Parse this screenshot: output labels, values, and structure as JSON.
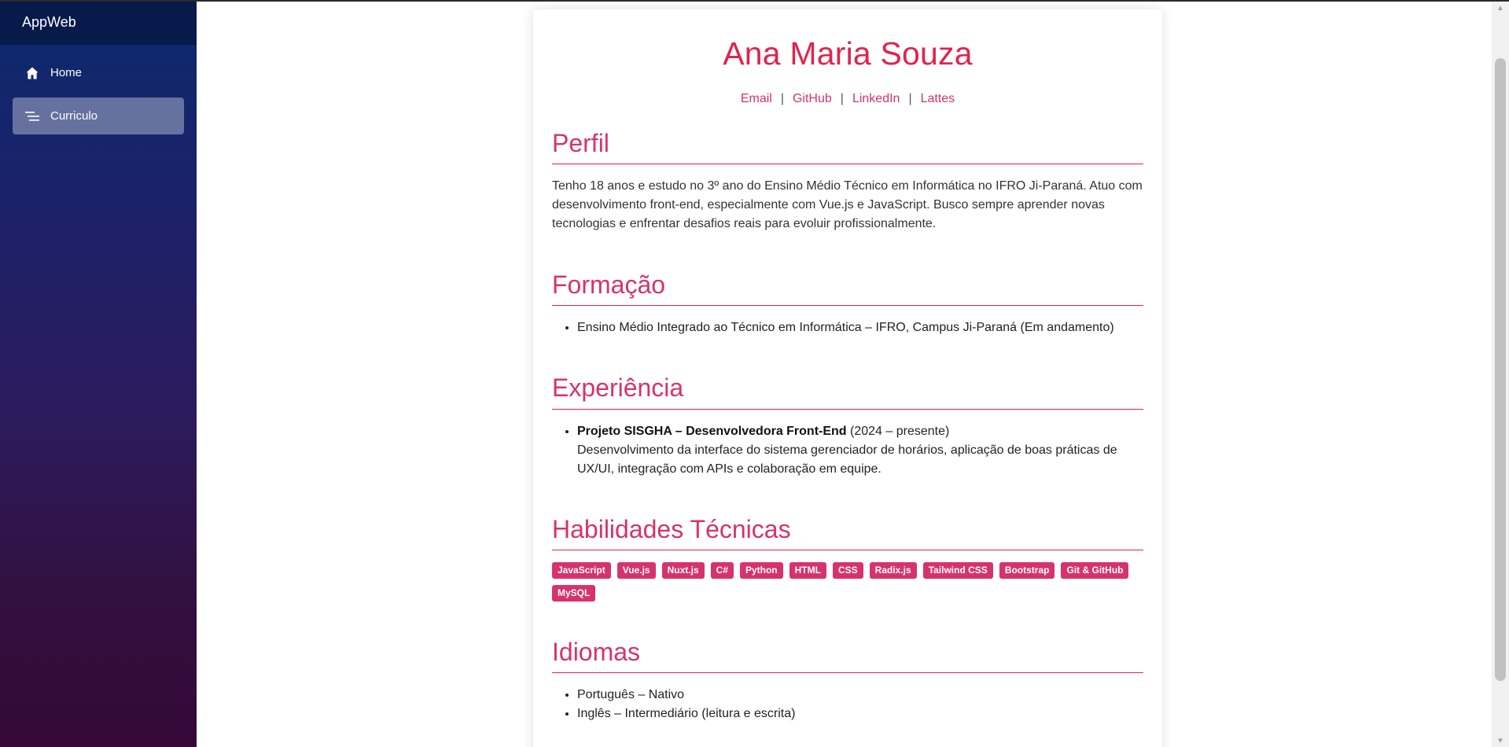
{
  "sidebar": {
    "brand": "AppWeb",
    "items": [
      {
        "label": "Home",
        "icon": "home-icon",
        "active": false
      },
      {
        "label": "Curriculo",
        "icon": "sort-lines-icon",
        "active": true
      }
    ]
  },
  "resume": {
    "name": "Ana Maria Souza",
    "links": [
      "Email",
      "GitHub",
      "LinkedIn",
      "Lattes"
    ],
    "separator": "|",
    "profile": {
      "title": "Perfil",
      "text": "Tenho 18 anos e estudo no 3º ano do Ensino Médio Técnico em Informática no IFRO Ji-Paraná. Atuo com desenvolvimento front-end, especialmente com Vue.js e JavaScript. Busco sempre aprender novas tecnologias e enfrentar desafios reais para evoluir profissionalmente."
    },
    "education": {
      "title": "Formação",
      "items": [
        "Ensino Médio Integrado ao Técnico em Informática – IFRO, Campus Ji-Paraná (Em andamento)"
      ]
    },
    "experience": {
      "title": "Experiência",
      "items": [
        {
          "role": "Projeto SISGHA – Desenvolvedora Front-End",
          "period": " (2024 – presente)",
          "description": "Desenvolvimento da interface do sistema gerenciador de horários, aplicação de boas práticas de UX/UI, integração com APIs e colaboração em equipe."
        }
      ]
    },
    "skills": {
      "title": "Habilidades Técnicas",
      "items": [
        "JavaScript",
        "Vue.js",
        "Nuxt.js",
        "C#",
        "Python",
        "HTML",
        "CSS",
        "Radix.js",
        "Tailwind CSS",
        "Bootstrap",
        "Git & GitHub",
        "MySQL"
      ]
    },
    "languages": {
      "title": "Idiomas",
      "items": [
        "Português – Nativo",
        "Inglês – Intermediário (leitura e escrita)"
      ]
    }
  },
  "colors": {
    "accent": "#d6336c",
    "name_color": "#e0234e",
    "sidebar_top": "#0c2a6e",
    "sidebar_bottom": "#350838"
  }
}
